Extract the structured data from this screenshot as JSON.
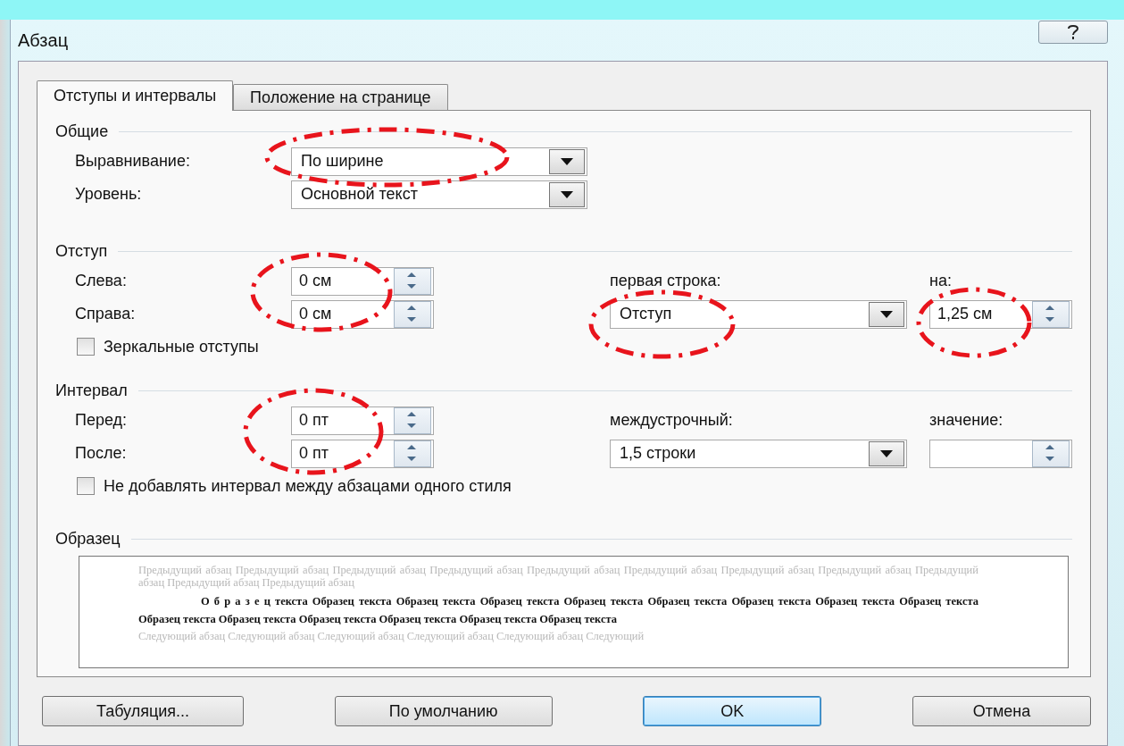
{
  "window": {
    "title": "Абзац"
  },
  "tabs": [
    {
      "label": "Отступы и интервалы",
      "selected": true
    },
    {
      "label": "Положение на странице",
      "selected": false
    }
  ],
  "general": {
    "title": "Общие",
    "alignment": {
      "label": "Выравнивание:",
      "value": "По ширине",
      "circled": true
    },
    "level": {
      "label": "Уровень:",
      "value": "Основной текст"
    }
  },
  "indent": {
    "title": "Отступ",
    "left": {
      "label": "Слева:",
      "value": "0 см",
      "circled": true
    },
    "right": {
      "label": "Справа:",
      "value": "0 см"
    },
    "first_line": {
      "label": "первая строка:",
      "value": "Отступ",
      "circled": true
    },
    "by": {
      "label": "на:",
      "value": "1,25 см",
      "circled": true
    },
    "mirror": {
      "label": "Зеркальные отступы",
      "checked": false
    }
  },
  "spacing": {
    "title": "Интервал",
    "before": {
      "label": "Перед:",
      "value": "0 пт",
      "circled": true
    },
    "after": {
      "label": "После:",
      "value": "0 пт"
    },
    "line_spacing": {
      "label": "междустрочный:",
      "value": "1,5 строки"
    },
    "at": {
      "label": "значение:"
    },
    "no_space": {
      "label": "Не добавлять интервал между абзацами одного стиля",
      "checked": false
    }
  },
  "preview": {
    "title": "Образец",
    "previous": "Предыдущий абзац Предыдущий абзац Предыдущий абзац Предыдущий абзац Предыдущий абзац Предыдущий абзац Предыдущий абзац Предыдущий абзац Предыдущий абзац Предыдущий абзац Предыдущий абзац",
    "sample": "О б р а з е ц текста Образец текста Образец текста Образец текста Образец текста Образец текста Образец текста Образец текста Образец текста Образец текста Образец текста Образец текста Образец текста Образец текста Образец текста",
    "next": "Следующий абзац Следующий абзац Следующий абзац Следующий абзац Следующий абзац Следующий"
  },
  "buttons": [
    {
      "label": "Табуляция...",
      "default": false
    },
    {
      "label": "По умолчанию",
      "default": false
    },
    {
      "label": "OK",
      "default": true
    },
    {
      "label": "Отмена",
      "default": false
    }
  ]
}
